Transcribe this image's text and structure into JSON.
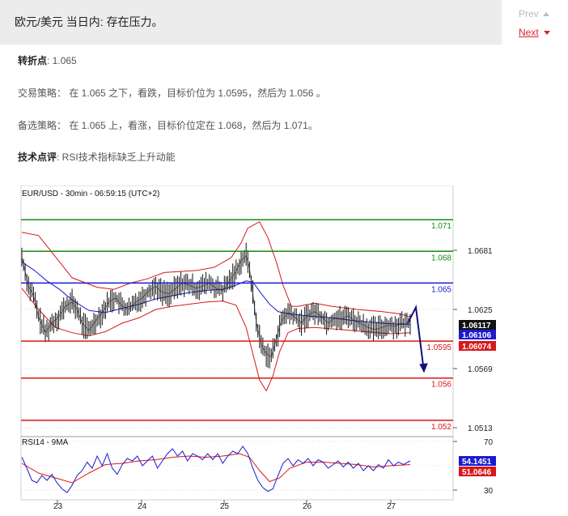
{
  "header": {
    "title": "欧元/美元 当日内: 存在压力。"
  },
  "nav": {
    "prev": "Prev",
    "next": "Next"
  },
  "analysis": {
    "pivot": {
      "label": "转折点",
      "value": ": 1.065"
    },
    "strategy": {
      "label": "交易策略",
      "value": "：   在 1.065 之下，看跌，目标价位为 1.0595，然后为 1.056 。"
    },
    "alternative": {
      "label": "备选策略",
      "value": "：   在 1.065 上，看涨，目标价位定在 1.068，然后为 1.071。"
    },
    "comment": {
      "label": "技术点评",
      "value": ": RSI技术指标缺乏上升动能"
    }
  },
  "chart_data": {
    "type": "line",
    "title": "EUR/USD - 30min - 06:59:15 (UTC+2)",
    "x_ticks": [
      "23",
      "24",
      "25",
      "26",
      "27"
    ],
    "y_ticks": [
      1.0681,
      1.0625,
      1.0569,
      1.0513
    ],
    "levels": [
      {
        "value": 1.071,
        "label": "1.071",
        "color": "#1a8a1a"
      },
      {
        "value": 1.068,
        "label": "1.068",
        "color": "#1a8a1a"
      },
      {
        "value": 1.065,
        "label": "1.065",
        "color": "#1b1bd0"
      },
      {
        "value": 1.0595,
        "label": "1.0595",
        "color": "#d81818"
      },
      {
        "value": 1.056,
        "label": "1.056",
        "color": "#d81818"
      },
      {
        "value": 1.052,
        "label": "1.052",
        "color": "#d81818"
      }
    ],
    "price_tags": [
      {
        "value": 1.06117,
        "label": "1.06117",
        "bg": "#111111"
      },
      {
        "value": 1.06106,
        "label": "1.06106",
        "bg": "#1b1bd0"
      },
      {
        "value": 1.06074,
        "label": "1.06074",
        "bg": "#d81818"
      }
    ],
    "projection": [
      [
        0.0,
        1.0612
      ],
      [
        0.5,
        1.0627
      ],
      [
        1.0,
        1.0566
      ]
    ],
    "price_path": [
      [
        0,
        1.0675
      ],
      [
        3,
        1.0664
      ],
      [
        8,
        1.0647
      ],
      [
        14,
        1.0638
      ],
      [
        20,
        1.0618
      ],
      [
        28,
        1.0603
      ],
      [
        36,
        1.0612
      ],
      [
        44,
        1.0618
      ],
      [
        52,
        1.0628
      ],
      [
        60,
        1.0632
      ],
      [
        66,
        1.0625
      ],
      [
        72,
        1.0612
      ],
      [
        80,
        1.0605
      ],
      [
        88,
        1.0614
      ],
      [
        96,
        1.0622
      ],
      [
        104,
        1.0632
      ],
      [
        112,
        1.0636
      ],
      [
        120,
        1.0628
      ],
      [
        128,
        1.0625
      ],
      [
        136,
        1.0632
      ],
      [
        144,
        1.0636
      ],
      [
        152,
        1.0643
      ],
      [
        160,
        1.0647
      ],
      [
        168,
        1.0641
      ],
      [
        176,
        1.064
      ],
      [
        184,
        1.0645
      ],
      [
        192,
        1.065
      ],
      [
        200,
        1.0648
      ],
      [
        208,
        1.0645
      ],
      [
        216,
        1.0647
      ],
      [
        224,
        1.065
      ],
      [
        232,
        1.0645
      ],
      [
        240,
        1.0643
      ],
      [
        248,
        1.0652
      ],
      [
        256,
        1.0661
      ],
      [
        262,
        1.0671
      ],
      [
        268,
        1.0676
      ],
      [
        272,
        1.0664
      ],
      [
        276,
        1.064
      ],
      [
        280,
        1.0613
      ],
      [
        286,
        1.0592
      ],
      [
        292,
        1.0583
      ],
      [
        298,
        1.058
      ],
      [
        304,
        1.0597
      ],
      [
        310,
        1.0614
      ],
      [
        318,
        1.0622
      ],
      [
        326,
        1.0618
      ],
      [
        334,
        1.0612
      ],
      [
        342,
        1.062
      ],
      [
        350,
        1.0623
      ],
      [
        358,
        1.0618
      ],
      [
        366,
        1.0612
      ],
      [
        374,
        1.0617
      ],
      [
        382,
        1.0616
      ],
      [
        390,
        1.0619
      ],
      [
        398,
        1.0614
      ],
      [
        406,
        1.0611
      ],
      [
        414,
        1.0608
      ],
      [
        422,
        1.0606
      ],
      [
        430,
        1.0608
      ],
      [
        438,
        1.061
      ],
      [
        446,
        1.0609
      ],
      [
        452,
        1.0612
      ],
      [
        458,
        1.0611
      ],
      [
        464,
        1.0614
      ]
    ],
    "band_upper": [
      [
        0,
        1.0698
      ],
      [
        20,
        1.0695
      ],
      [
        40,
        1.0675
      ],
      [
        60,
        1.0655
      ],
      [
        90,
        1.0646
      ],
      [
        110,
        1.0644
      ],
      [
        130,
        1.065
      ],
      [
        150,
        1.0654
      ],
      [
        170,
        1.066
      ],
      [
        190,
        1.0661
      ],
      [
        210,
        1.0662
      ],
      [
        230,
        1.0665
      ],
      [
        250,
        1.0674
      ],
      [
        262,
        1.0688
      ],
      [
        270,
        1.0702
      ],
      [
        284,
        1.0708
      ],
      [
        294,
        1.0693
      ],
      [
        304,
        1.067
      ],
      [
        312,
        1.0648
      ],
      [
        322,
        1.0628
      ],
      [
        330,
        1.0628
      ],
      [
        350,
        1.0631
      ],
      [
        370,
        1.0628
      ],
      [
        400,
        1.0625
      ],
      [
        430,
        1.0623
      ],
      [
        450,
        1.0621
      ],
      [
        464,
        1.0618
      ]
    ],
    "band_lower": [
      [
        0,
        1.0645
      ],
      [
        20,
        1.0625
      ],
      [
        40,
        1.0608
      ],
      [
        60,
        1.0603
      ],
      [
        80,
        1.06
      ],
      [
        100,
        1.0604
      ],
      [
        120,
        1.0612
      ],
      [
        140,
        1.0617
      ],
      [
        160,
        1.0625
      ],
      [
        180,
        1.0628
      ],
      [
        200,
        1.063
      ],
      [
        220,
        1.0632
      ],
      [
        240,
        1.0633
      ],
      [
        256,
        1.0629
      ],
      [
        268,
        1.0608
      ],
      [
        276,
        1.0583
      ],
      [
        284,
        1.0558
      ],
      [
        292,
        1.0548
      ],
      [
        300,
        1.0562
      ],
      [
        308,
        1.0585
      ],
      [
        318,
        1.0603
      ],
      [
        330,
        1.0607
      ],
      [
        350,
        1.0608
      ],
      [
        380,
        1.0606
      ],
      [
        410,
        1.0604
      ],
      [
        440,
        1.0602
      ],
      [
        464,
        1.0603
      ]
    ],
    "ma_line": [
      [
        0,
        1.067
      ],
      [
        15,
        1.0662
      ],
      [
        30,
        1.0652
      ],
      [
        45,
        1.0644
      ],
      [
        60,
        1.0634
      ],
      [
        80,
        1.0624
      ],
      [
        100,
        1.0622
      ],
      [
        120,
        1.0626
      ],
      [
        140,
        1.063
      ],
      [
        160,
        1.0635
      ],
      [
        180,
        1.0638
      ],
      [
        200,
        1.0641
      ],
      [
        220,
        1.0643
      ],
      [
        240,
        1.0644
      ],
      [
        256,
        1.0648
      ],
      [
        268,
        1.0652
      ],
      [
        276,
        1.0651
      ],
      [
        286,
        1.064
      ],
      [
        296,
        1.063
      ],
      [
        306,
        1.0623
      ],
      [
        318,
        1.0621
      ],
      [
        340,
        1.0619
      ],
      [
        370,
        1.0617
      ],
      [
        400,
        1.0614
      ],
      [
        430,
        1.0612
      ],
      [
        450,
        1.0611
      ],
      [
        464,
        1.0611
      ]
    ],
    "rsi": {
      "label": "RSI14 - 9MA",
      "ticks": [
        70,
        30
      ],
      "value": "54.1451",
      "ma_value": "51.0646",
      "rsi_path": [
        [
          0,
          57
        ],
        [
          6,
          48
        ],
        [
          12,
          38
        ],
        [
          18,
          36
        ],
        [
          24,
          42
        ],
        [
          30,
          38
        ],
        [
          36,
          43
        ],
        [
          42,
          36
        ],
        [
          48,
          31
        ],
        [
          54,
          28
        ],
        [
          60,
          34
        ],
        [
          66,
          42
        ],
        [
          72,
          46
        ],
        [
          78,
          53
        ],
        [
          84,
          48
        ],
        [
          90,
          58
        ],
        [
          96,
          50
        ],
        [
          102,
          60
        ],
        [
          108,
          48
        ],
        [
          114,
          43
        ],
        [
          120,
          51
        ],
        [
          126,
          56
        ],
        [
          132,
          54
        ],
        [
          138,
          58
        ],
        [
          144,
          50
        ],
        [
          150,
          54
        ],
        [
          156,
          58
        ],
        [
          162,
          48
        ],
        [
          168,
          54
        ],
        [
          174,
          60
        ],
        [
          180,
          64
        ],
        [
          186,
          58
        ],
        [
          192,
          62
        ],
        [
          198,
          54
        ],
        [
          204,
          60
        ],
        [
          210,
          58
        ],
        [
          216,
          55
        ],
        [
          222,
          60
        ],
        [
          228,
          55
        ],
        [
          234,
          60
        ],
        [
          240,
          52
        ],
        [
          246,
          58
        ],
        [
          252,
          62
        ],
        [
          258,
          60
        ],
        [
          264,
          66
        ],
        [
          270,
          60
        ],
        [
          276,
          48
        ],
        [
          282,
          38
        ],
        [
          288,
          32
        ],
        [
          294,
          29
        ],
        [
          300,
          31
        ],
        [
          306,
          42
        ],
        [
          312,
          52
        ],
        [
          318,
          56
        ],
        [
          324,
          50
        ],
        [
          330,
          55
        ],
        [
          336,
          52
        ],
        [
          342,
          56
        ],
        [
          348,
          50
        ],
        [
          354,
          55
        ],
        [
          360,
          53
        ],
        [
          366,
          48
        ],
        [
          372,
          51
        ],
        [
          378,
          54
        ],
        [
          384,
          49
        ],
        [
          390,
          53
        ],
        [
          396,
          48
        ],
        [
          402,
          52
        ],
        [
          408,
          46
        ],
        [
          414,
          50
        ],
        [
          420,
          46
        ],
        [
          426,
          51
        ],
        [
          432,
          48
        ],
        [
          438,
          55
        ],
        [
          444,
          50
        ],
        [
          450,
          53
        ],
        [
          456,
          51
        ],
        [
          464,
          54
        ]
      ],
      "ma_path": [
        [
          0,
          52
        ],
        [
          20,
          44
        ],
        [
          40,
          40
        ],
        [
          60,
          36
        ],
        [
          80,
          44
        ],
        [
          100,
          51
        ],
        [
          120,
          52
        ],
        [
          140,
          54
        ],
        [
          160,
          55
        ],
        [
          180,
          57
        ],
        [
          200,
          58
        ],
        [
          220,
          57
        ],
        [
          240,
          58
        ],
        [
          260,
          60
        ],
        [
          272,
          57
        ],
        [
          284,
          46
        ],
        [
          296,
          37
        ],
        [
          308,
          40
        ],
        [
          320,
          48
        ],
        [
          340,
          53
        ],
        [
          360,
          53
        ],
        [
          380,
          52
        ],
        [
          400,
          51
        ],
        [
          420,
          49
        ],
        [
          440,
          50
        ],
        [
          464,
          51
        ]
      ]
    }
  }
}
